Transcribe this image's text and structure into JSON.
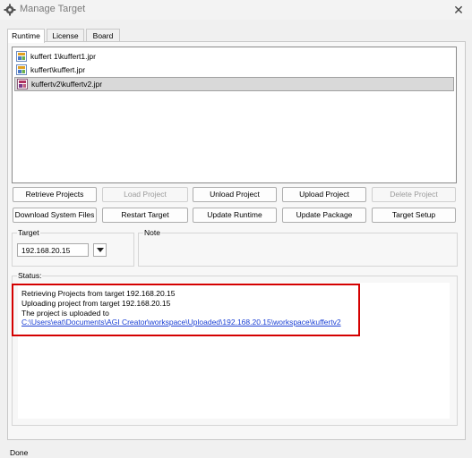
{
  "window": {
    "title": "Manage Target",
    "close_glyph": "✕"
  },
  "tabs": [
    {
      "label": "Runtime",
      "active": true
    },
    {
      "label": "License",
      "active": false
    },
    {
      "label": "Board",
      "active": false
    }
  ],
  "projects": [
    {
      "label": "kuffert 1\\kuffert1.jpr",
      "selected": false
    },
    {
      "label": "kuffert\\kuffert.jpr",
      "selected": false
    },
    {
      "label": "kuffertv2\\kuffertv2.jpr",
      "selected": true
    }
  ],
  "buttons": {
    "retrieve_projects": "Retrieve Projects",
    "load_project": "Load Project",
    "unload_project": "Unload Project",
    "upload_project": "Upload Project",
    "delete_project": "Delete Project",
    "download_system_files": "Download System Files",
    "restart_target": "Restart Target",
    "update_runtime": "Update Runtime",
    "update_package": "Update Package",
    "target_setup": "Target Setup"
  },
  "target": {
    "label": "Target",
    "value": "192.168.20.15"
  },
  "note": {
    "label": "Note"
  },
  "status": {
    "label": "Status:",
    "lines": [
      "Retrieving Projects from target 192.168.20.15",
      "Uploading  project from target 192.168.20.15",
      "The project is uploaded to"
    ],
    "path": "C:\\Users\\eat\\Documents\\AGI Creator\\workspace\\Uploaded\\192.168.20.15\\workspace\\kuffertv2"
  },
  "statusbar": {
    "text": "Done"
  },
  "colors": {
    "highlight": "#d40000",
    "link": "#1a3fd4",
    "selection": "#d9d9d9"
  }
}
